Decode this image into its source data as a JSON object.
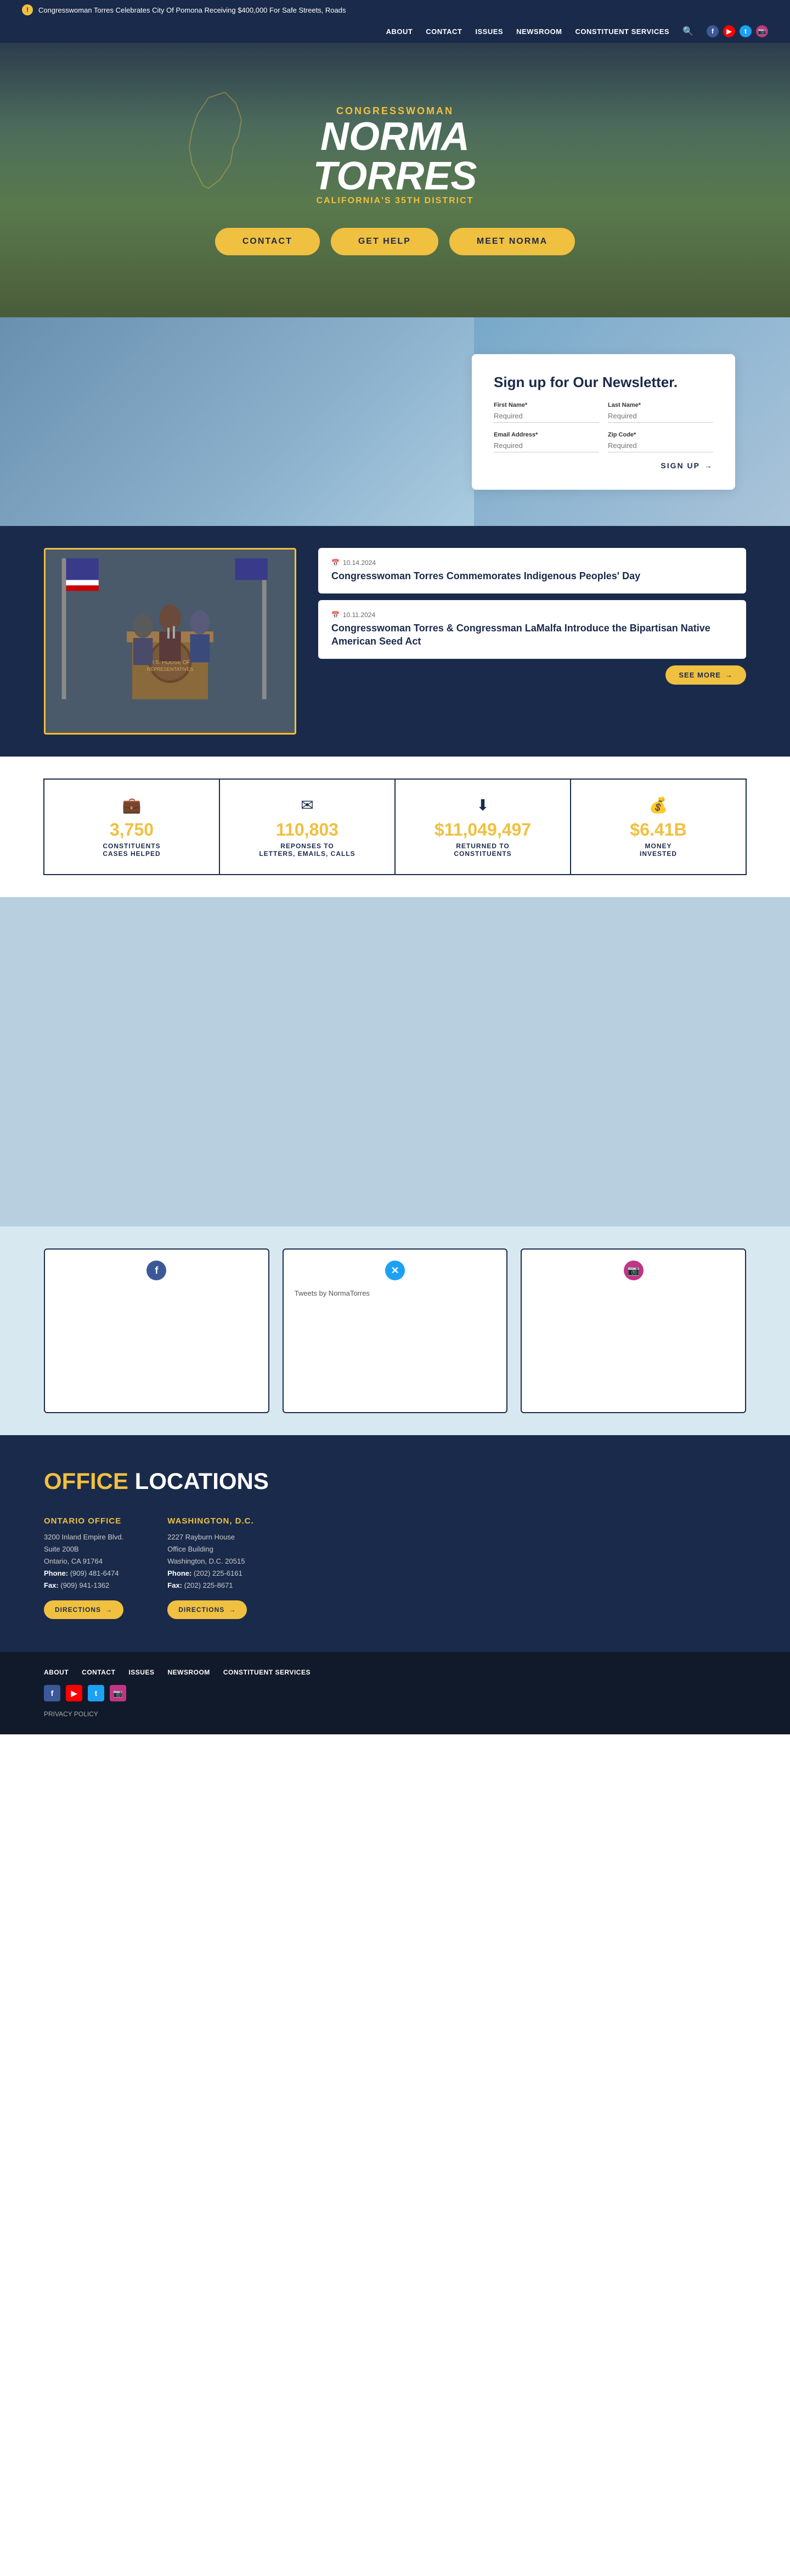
{
  "alert": {
    "icon": "!",
    "text": "Congresswoman Torres Celebrates City Of Pomona Receiving $400,000 For Safe Streets, Roads"
  },
  "nav": {
    "links": [
      "ABOUT",
      "CONTACT",
      "ISSUES",
      "NEWSROOM",
      "CONSTITUENT SERVICES"
    ],
    "social": [
      "f",
      "▶",
      "t",
      "📷"
    ]
  },
  "hero": {
    "eyebrow": "CONGRESSWOMAN",
    "name_line1": "NORMA",
    "name_line2": "TORRES",
    "district": "CALIFORNIA'S 35TH DISTRICT",
    "button1": "CONTACT",
    "button2": "GET HELP",
    "button3": "MEET NORMA"
  },
  "newsletter": {
    "title": "Sign up for Our Newsletter.",
    "first_name_label": "First Name*",
    "first_name_placeholder": "Required",
    "last_name_label": "Last Name*",
    "last_name_placeholder": "Required",
    "email_label": "Email Address*",
    "email_placeholder": "Required",
    "zip_label": "Zip Code*",
    "zip_placeholder": "Required",
    "button": "SIGN UP"
  },
  "news": {
    "articles": [
      {
        "date": "10.14.2024",
        "title": "Congresswoman Torres Commemorates Indigenous Peoples' Day"
      },
      {
        "date": "10.11.2024",
        "title": "Congresswoman Torres & Congressman LaMalfa Introduce the Bipartisan Native American Seed Act"
      }
    ],
    "see_more": "SEE MORE"
  },
  "stats": [
    {
      "icon": "💼",
      "number": "3,750",
      "label": "CONSTITUENTS\nCASES HELPED"
    },
    {
      "icon": "✉",
      "number": "110,803",
      "label": "REPONSES TO\nLETTERS, EMAILS, CALLS"
    },
    {
      "icon": "⬇",
      "number": "$11,049,497",
      "label": "RETURNED TO\nCONSTITUENTS"
    },
    {
      "icon": "💰",
      "number": "$6.41B",
      "label": "MONEY\nINVESTED"
    }
  ],
  "social": {
    "facebook_label": "Facebook",
    "twitter_label": "Tweets by NormaTorres",
    "instagram_label": "Instagram"
  },
  "offices": {
    "section_title_highlight": "OFFICE",
    "section_title_rest": " LOCATIONS",
    "ontario": {
      "name": "ONTARIO OFFICE",
      "address_line1": "3200 Inland Empire Blvd.",
      "address_line2": "Suite 200B",
      "address_line3": "Ontario, CA 91764",
      "phone": "Phone: (909) 481-6474",
      "fax": "Fax: (909) 941-1362",
      "directions_btn": "DIRECTIONS"
    },
    "dc": {
      "name": "WASHINGTON, D.C.",
      "address_line1": "2227 Rayburn House",
      "address_line2": "Office Building",
      "address_line3": "Washington, D.C. 20515",
      "phone": "Phone: (202) 225-6161",
      "fax": "Fax: (202) 225-8671",
      "directions_btn": "DIRECTIONS"
    }
  },
  "footer": {
    "links": [
      "ABOUT",
      "CONTACT",
      "ISSUES",
      "NEWSROOM",
      "CONSTITUENT SERVICES"
    ],
    "privacy": "PRIVACY POLICY"
  }
}
